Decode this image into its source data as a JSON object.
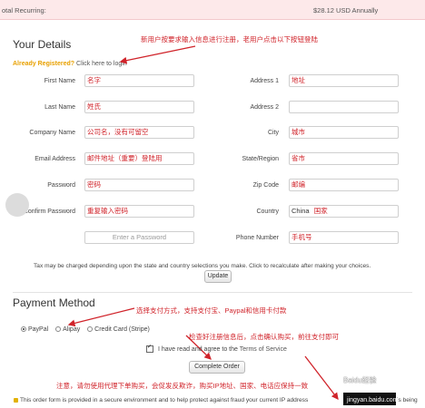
{
  "top_bar": {
    "left": "otal Recurring:",
    "right": "$28.12 USD Annually"
  },
  "your_details": {
    "title": "Your Details",
    "already_registered": "Already Registered?",
    "login_link": "Click here to login",
    "annotation": "新用户按要求输入信息进行注册，老用户点击以下按钮登陆"
  },
  "fields": {
    "first_name": {
      "label": "First Name",
      "value": "名字"
    },
    "last_name": {
      "label": "Last Name",
      "value": "姓氏"
    },
    "company": {
      "label": "Company Name",
      "value": "公司名，没有可留空"
    },
    "email": {
      "label": "Email Address",
      "value": "邮件地址（重要）登陆用"
    },
    "password": {
      "label": "Password",
      "value": "密码"
    },
    "confirm_password": {
      "label": "Confirm Password",
      "value": "重复输入密码"
    },
    "password_strength": {
      "placeholder": "Enter a Password"
    },
    "address1": {
      "label": "Address 1",
      "value": "地址"
    },
    "address2": {
      "label": "Address 2",
      "value": ""
    },
    "city": {
      "label": "City",
      "value": "城市"
    },
    "state": {
      "label": "State/Region",
      "value": "省市"
    },
    "zip": {
      "label": "Zip Code",
      "value": "邮编"
    },
    "country": {
      "label": "Country",
      "value": "China",
      "note": "国家"
    },
    "phone": {
      "label": "Phone Number",
      "value": "手机号"
    }
  },
  "tax": {
    "text": "Tax may be charged depending upon the state and country selections you make. Click to recalculate after making your choices.",
    "update_button": "Update"
  },
  "payment": {
    "title": "Payment Method",
    "annotation": "选择支付方式，支持支付宝、Paypal和信用卡付款",
    "options": [
      "PayPal",
      "Alipay",
      "Credit Card (Stripe)"
    ],
    "selected": "PayPal"
  },
  "terms": {
    "annotation": "检查好注册信息后，点击确认购买，前往支付即可",
    "text": "I have read and agree to the",
    "link": "Terms of Service"
  },
  "complete_button": "Complete Order",
  "footer": {
    "annotation": "注意，请勿使用代理下单购买，会促发反欺诈，购买IP地址、国家、电话应保持一致",
    "text": "This order form is provided in a secure environment and to help protect against fraud your current IP address",
    "trailing": "is being",
    "watermark": "Baidu经验",
    "watermark_url": "jingyan.baidu.com"
  },
  "colors": {
    "annotation": "#d0232a",
    "link_orange": "#e8a000",
    "top_bar_bg": "#fde9ea"
  }
}
